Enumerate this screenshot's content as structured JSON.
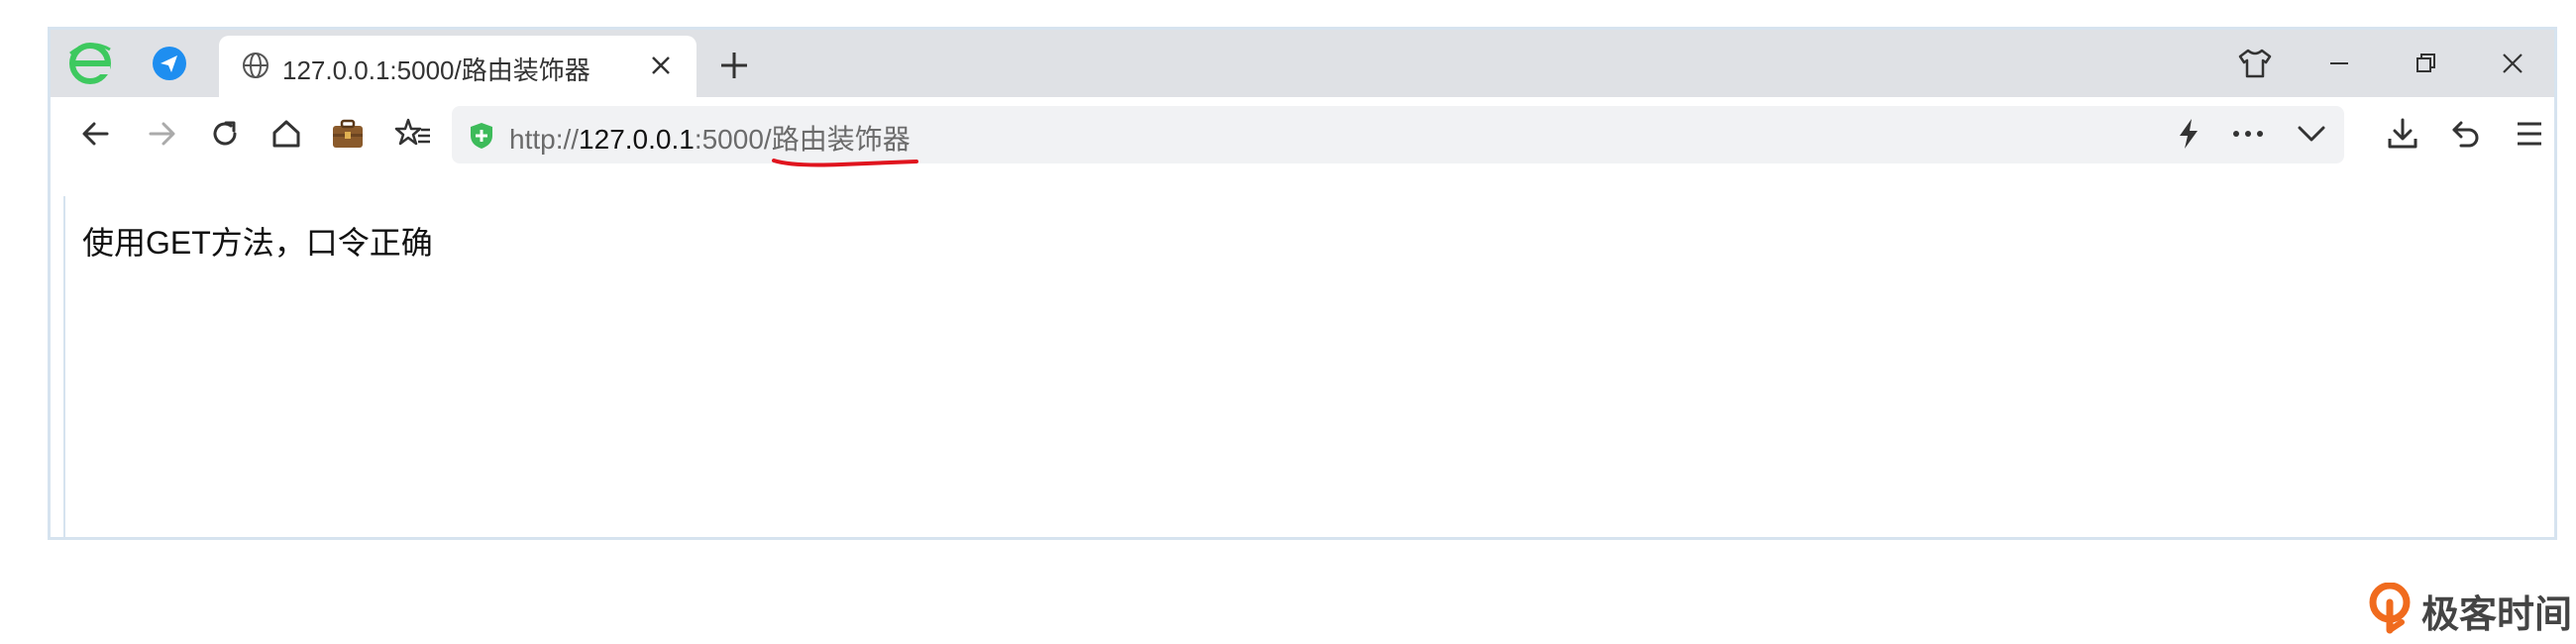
{
  "browser": {
    "tab": {
      "title": "127.0.0.1:5000/路由装饰器"
    },
    "address": {
      "scheme": "http://",
      "host": "127.0.0.1",
      "port": ":5000/",
      "path": "路由装饰器"
    }
  },
  "page": {
    "text": "使用GET方法，口令正确"
  },
  "watermark": {
    "text": "极客时间"
  },
  "icons": {
    "browser_logo": "ie-logo-icon",
    "telegram": "paper-plane-icon",
    "globe": "globe-icon",
    "close": "close-icon",
    "new_tab": "plus-icon",
    "skin": "tshirt-icon",
    "back": "arrow-left-icon",
    "forward": "arrow-right-icon",
    "reload": "reload-icon",
    "home": "home-icon",
    "briefcase": "briefcase-icon",
    "favorites": "star-list-icon",
    "secure": "shield-plus-icon",
    "lightning": "lightning-icon",
    "more": "ellipsis-icon",
    "dropdown": "chevron-down-icon",
    "download": "download-icon",
    "undo": "undo-icon",
    "menu": "hamburger-icon"
  },
  "colors": {
    "logo_green": "#3ec95f",
    "telegram_blue": "#1e8ef0",
    "secure_green": "#3dbb5a",
    "underline_red": "#e0141e",
    "watermark_orange": "#f06b1e"
  }
}
